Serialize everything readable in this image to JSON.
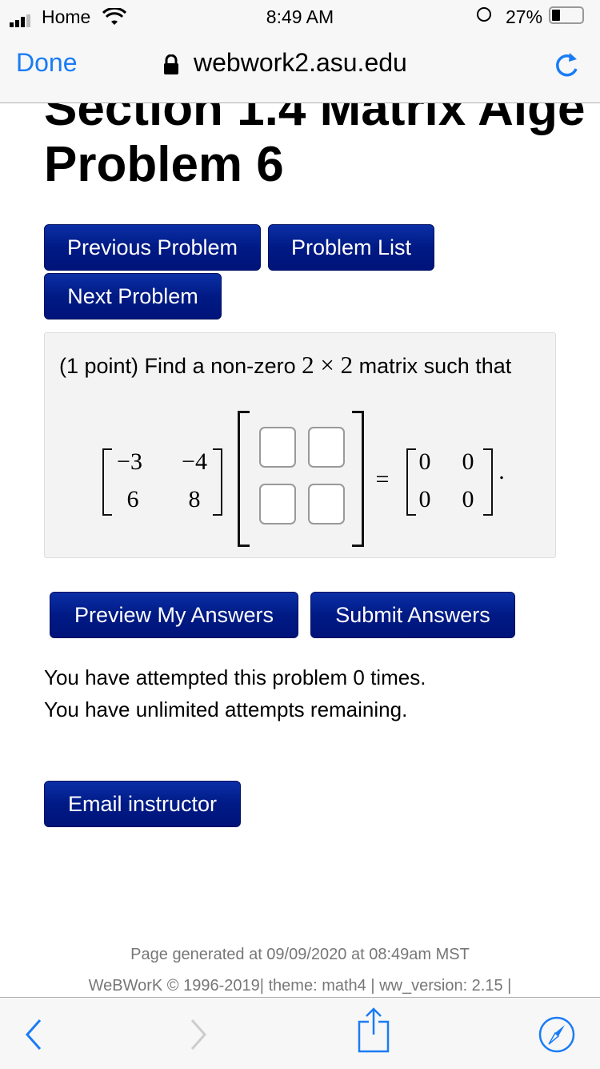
{
  "status_bar": {
    "carrier": "Home",
    "time": "8:49 AM",
    "battery": "27%",
    "battery_level": 0.27
  },
  "nav_bar": {
    "done": "Done",
    "url": "webwork2.asu.edu"
  },
  "page": {
    "title_line1": "Section 1.4 Matrix Alge",
    "title_line2": "Problem 6",
    "buttons": {
      "previous": "Previous Problem",
      "list": "Problem List",
      "next": "Next Problem"
    },
    "problem": {
      "text": "(1 point) Find a non-zero",
      "dims": "2 × 2",
      "text_end": "matrix such that",
      "matrix_a": [
        "−3",
        "−4",
        "6",
        "8"
      ],
      "answers": [
        "",
        "",
        "",
        ""
      ],
      "equals": "=",
      "matrix_result": [
        "0",
        "0",
        "0",
        "0"
      ],
      "period": "."
    },
    "preview": "Preview My Answers",
    "submit": "Submit Answers",
    "attempts_line1": "You have attempted this problem 0 times.",
    "attempts_line2": "You have unlimited attempts remaining.",
    "email": "Email instructor",
    "footer_line1": "Page generated at 09/09/2020 at 08:49am MST",
    "footer_line2": "WeBWorK © 1996-2019| theme: math4 | ww_version: 2.15 |"
  },
  "colors": {
    "ios_blue": "#1a7cf5",
    "button": "#001a85"
  }
}
